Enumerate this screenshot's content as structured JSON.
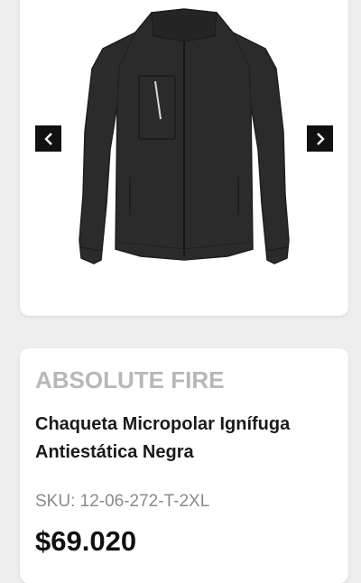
{
  "gallery": {
    "image_subject": "jacket-image",
    "prev_icon": "chevron-left-icon",
    "next_icon": "chevron-right-icon"
  },
  "product": {
    "brand": "ABSOLUTE FIRE",
    "title": "Chaqueta Micropolar Ignífuga Antiestática Negra",
    "sku_label": "SKU: ",
    "sku_value": "12-06-272-T-2XL",
    "price": "$69.020"
  },
  "colors": {
    "background": "#eeeeef",
    "card": "#ffffff",
    "brand": "#b8b8b8",
    "title": "#1a1a1a",
    "sku": "#8a8a8a",
    "price": "#111111",
    "arrow_bg": "#111111",
    "jacket": "#2b2b2b"
  }
}
